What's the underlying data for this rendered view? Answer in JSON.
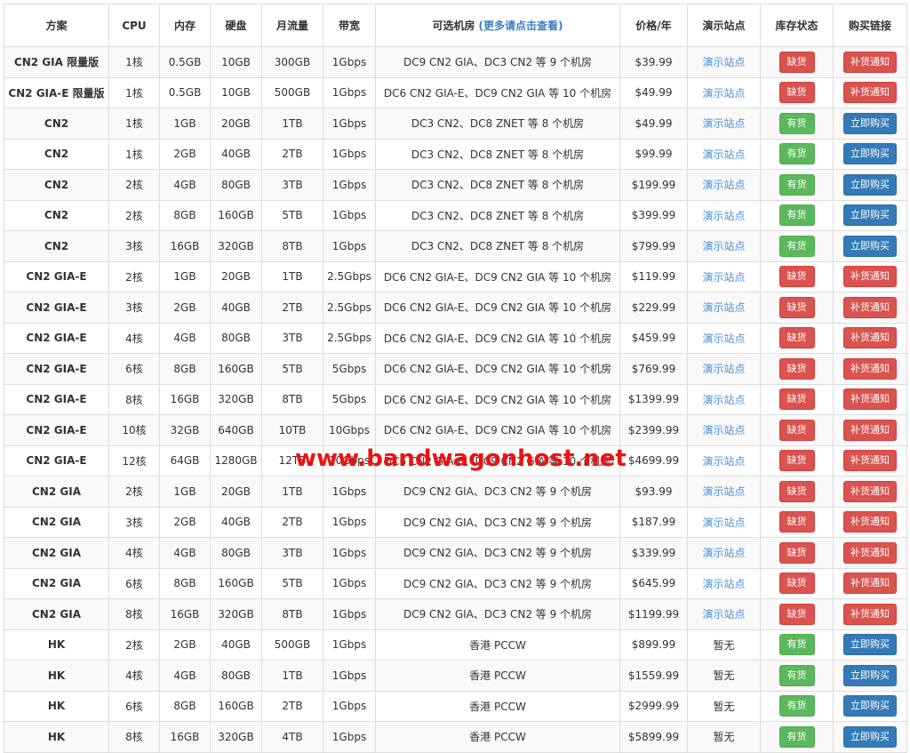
{
  "headers": {
    "plan": "方案",
    "cpu": "CPU",
    "ram": "内存",
    "disk": "硬盘",
    "traffic": "月流量",
    "bandwidth": "带宽",
    "datacenters": "可选机房",
    "more_link": "(更多请点击查看)",
    "price": "价格/年",
    "demo": "演示站点",
    "stock": "库存状态",
    "buy": "购买链接"
  },
  "labels": {
    "demo_site": "演示站点",
    "no_demo": "暂无",
    "out_of_stock": "缺货",
    "in_stock": "有货",
    "restock_notify": "补货通知",
    "buy_now": "立即购买"
  },
  "colors": {
    "out_of_stock": "#d9534f",
    "in_stock": "#5cb85c",
    "buy_now": "#337ab7",
    "link": "#4a90d9",
    "watermark": "#ee1111"
  },
  "watermark": "www.bandwagonhost.net",
  "rows": [
    {
      "plan": "CN2 GIA 限量版",
      "cpu": "1核",
      "ram": "0.5GB",
      "disk": "10GB",
      "traffic": "300GB",
      "bw": "1Gbps",
      "dc": "DC9 CN2 GIA、DC3 CN2 等 9 个机房",
      "price": "$39.99",
      "demo": "demo",
      "stock": "out"
    },
    {
      "plan": "CN2 GIA-E 限量版",
      "cpu": "1核",
      "ram": "0.5GB",
      "disk": "10GB",
      "traffic": "500GB",
      "bw": "1Gbps",
      "dc": "DC6 CN2 GIA-E、DC9 CN2 GIA 等 10 个机房",
      "price": "$49.99",
      "demo": "demo",
      "stock": "out"
    },
    {
      "plan": "CN2",
      "cpu": "1核",
      "ram": "1GB",
      "disk": "20GB",
      "traffic": "1TB",
      "bw": "1Gbps",
      "dc": "DC3 CN2、DC8 ZNET 等 8 个机房",
      "price": "$49.99",
      "demo": "demo",
      "stock": "in"
    },
    {
      "plan": "CN2",
      "cpu": "1核",
      "ram": "2GB",
      "disk": "40GB",
      "traffic": "2TB",
      "bw": "1Gbps",
      "dc": "DC3 CN2、DC8 ZNET 等 8 个机房",
      "price": "$99.99",
      "demo": "demo",
      "stock": "in"
    },
    {
      "plan": "CN2",
      "cpu": "2核",
      "ram": "4GB",
      "disk": "80GB",
      "traffic": "3TB",
      "bw": "1Gbps",
      "dc": "DC3 CN2、DC8 ZNET 等 8 个机房",
      "price": "$199.99",
      "demo": "demo",
      "stock": "in"
    },
    {
      "plan": "CN2",
      "cpu": "2核",
      "ram": "8GB",
      "disk": "160GB",
      "traffic": "5TB",
      "bw": "1Gbps",
      "dc": "DC3 CN2、DC8 ZNET 等 8 个机房",
      "price": "$399.99",
      "demo": "demo",
      "stock": "in"
    },
    {
      "plan": "CN2",
      "cpu": "3核",
      "ram": "16GB",
      "disk": "320GB",
      "traffic": "8TB",
      "bw": "1Gbps",
      "dc": "DC3 CN2、DC8 ZNET 等 8 个机房",
      "price": "$799.99",
      "demo": "demo",
      "stock": "in"
    },
    {
      "plan": "CN2 GIA-E",
      "cpu": "2核",
      "ram": "1GB",
      "disk": "20GB",
      "traffic": "1TB",
      "bw": "2.5Gbps",
      "dc": "DC6 CN2 GIA-E、DC9 CN2 GIA 等 10 个机房",
      "price": "$119.99",
      "demo": "demo",
      "stock": "out"
    },
    {
      "plan": "CN2 GIA-E",
      "cpu": "3核",
      "ram": "2GB",
      "disk": "40GB",
      "traffic": "2TB",
      "bw": "2.5Gbps",
      "dc": "DC6 CN2 GIA-E、DC9 CN2 GIA 等 10 个机房",
      "price": "$229.99",
      "demo": "demo",
      "stock": "out"
    },
    {
      "plan": "CN2 GIA-E",
      "cpu": "4核",
      "ram": "4GB",
      "disk": "80GB",
      "traffic": "3TB",
      "bw": "2.5Gbps",
      "dc": "DC6 CN2 GIA-E、DC9 CN2 GIA 等 10 个机房",
      "price": "$459.99",
      "demo": "demo",
      "stock": "out"
    },
    {
      "plan": "CN2 GIA-E",
      "cpu": "6核",
      "ram": "8GB",
      "disk": "160GB",
      "traffic": "5TB",
      "bw": "5Gbps",
      "dc": "DC6 CN2 GIA-E、DC9 CN2 GIA 等 10 个机房",
      "price": "$769.99",
      "demo": "demo",
      "stock": "out"
    },
    {
      "plan": "CN2 GIA-E",
      "cpu": "8核",
      "ram": "16GB",
      "disk": "320GB",
      "traffic": "8TB",
      "bw": "5Gbps",
      "dc": "DC6 CN2 GIA-E、DC9 CN2 GIA 等 10 个机房",
      "price": "$1399.99",
      "demo": "demo",
      "stock": "out"
    },
    {
      "plan": "CN2 GIA-E",
      "cpu": "10核",
      "ram": "32GB",
      "disk": "640GB",
      "traffic": "10TB",
      "bw": "10Gbps",
      "dc": "DC6 CN2 GIA-E、DC9 CN2 GIA 等 10 个机房",
      "price": "$2399.99",
      "demo": "demo",
      "stock": "out"
    },
    {
      "plan": "CN2 GIA-E",
      "cpu": "12核",
      "ram": "64GB",
      "disk": "1280GB",
      "traffic": "12TB",
      "bw": "10Gbps",
      "dc": "DC6 CN2 GIA-E、DC9 CN2 GIA 等 10 个机房",
      "price": "$4699.99",
      "demo": "demo",
      "stock": "out"
    },
    {
      "plan": "CN2 GIA",
      "cpu": "2核",
      "ram": "1GB",
      "disk": "20GB",
      "traffic": "1TB",
      "bw": "1Gbps",
      "dc": "DC9 CN2 GIA、DC3 CN2 等 9 个机房",
      "price": "$93.99",
      "demo": "demo",
      "stock": "out"
    },
    {
      "plan": "CN2 GIA",
      "cpu": "3核",
      "ram": "2GB",
      "disk": "40GB",
      "traffic": "2TB",
      "bw": "1Gbps",
      "dc": "DC9 CN2 GIA、DC3 CN2 等 9 个机房",
      "price": "$187.99",
      "demo": "demo",
      "stock": "out"
    },
    {
      "plan": "CN2 GIA",
      "cpu": "4核",
      "ram": "4GB",
      "disk": "80GB",
      "traffic": "3TB",
      "bw": "1Gbps",
      "dc": "DC9 CN2 GIA、DC3 CN2 等 9 个机房",
      "price": "$339.99",
      "demo": "demo",
      "stock": "out"
    },
    {
      "plan": "CN2 GIA",
      "cpu": "6核",
      "ram": "8GB",
      "disk": "160GB",
      "traffic": "5TB",
      "bw": "1Gbps",
      "dc": "DC9 CN2 GIA、DC3 CN2 等 9 个机房",
      "price": "$645.99",
      "demo": "demo",
      "stock": "out"
    },
    {
      "plan": "CN2 GIA",
      "cpu": "8核",
      "ram": "16GB",
      "disk": "320GB",
      "traffic": "8TB",
      "bw": "1Gbps",
      "dc": "DC9 CN2 GIA、DC3 CN2 等 9 个机房",
      "price": "$1199.99",
      "demo": "demo",
      "stock": "out"
    },
    {
      "plan": "HK",
      "cpu": "2核",
      "ram": "2GB",
      "disk": "40GB",
      "traffic": "500GB",
      "bw": "1Gbps",
      "dc": "香港 PCCW",
      "price": "$899.99",
      "demo": "none",
      "stock": "in"
    },
    {
      "plan": "HK",
      "cpu": "4核",
      "ram": "4GB",
      "disk": "80GB",
      "traffic": "1TB",
      "bw": "1Gbps",
      "dc": "香港 PCCW",
      "price": "$1559.99",
      "demo": "none",
      "stock": "in"
    },
    {
      "plan": "HK",
      "cpu": "6核",
      "ram": "8GB",
      "disk": "160GB",
      "traffic": "2TB",
      "bw": "1Gbps",
      "dc": "香港 PCCW",
      "price": "$2999.99",
      "demo": "none",
      "stock": "in"
    },
    {
      "plan": "HK",
      "cpu": "8核",
      "ram": "16GB",
      "disk": "320GB",
      "traffic": "4TB",
      "bw": "1Gbps",
      "dc": "香港 PCCW",
      "price": "$5899.99",
      "demo": "none",
      "stock": "in"
    }
  ]
}
